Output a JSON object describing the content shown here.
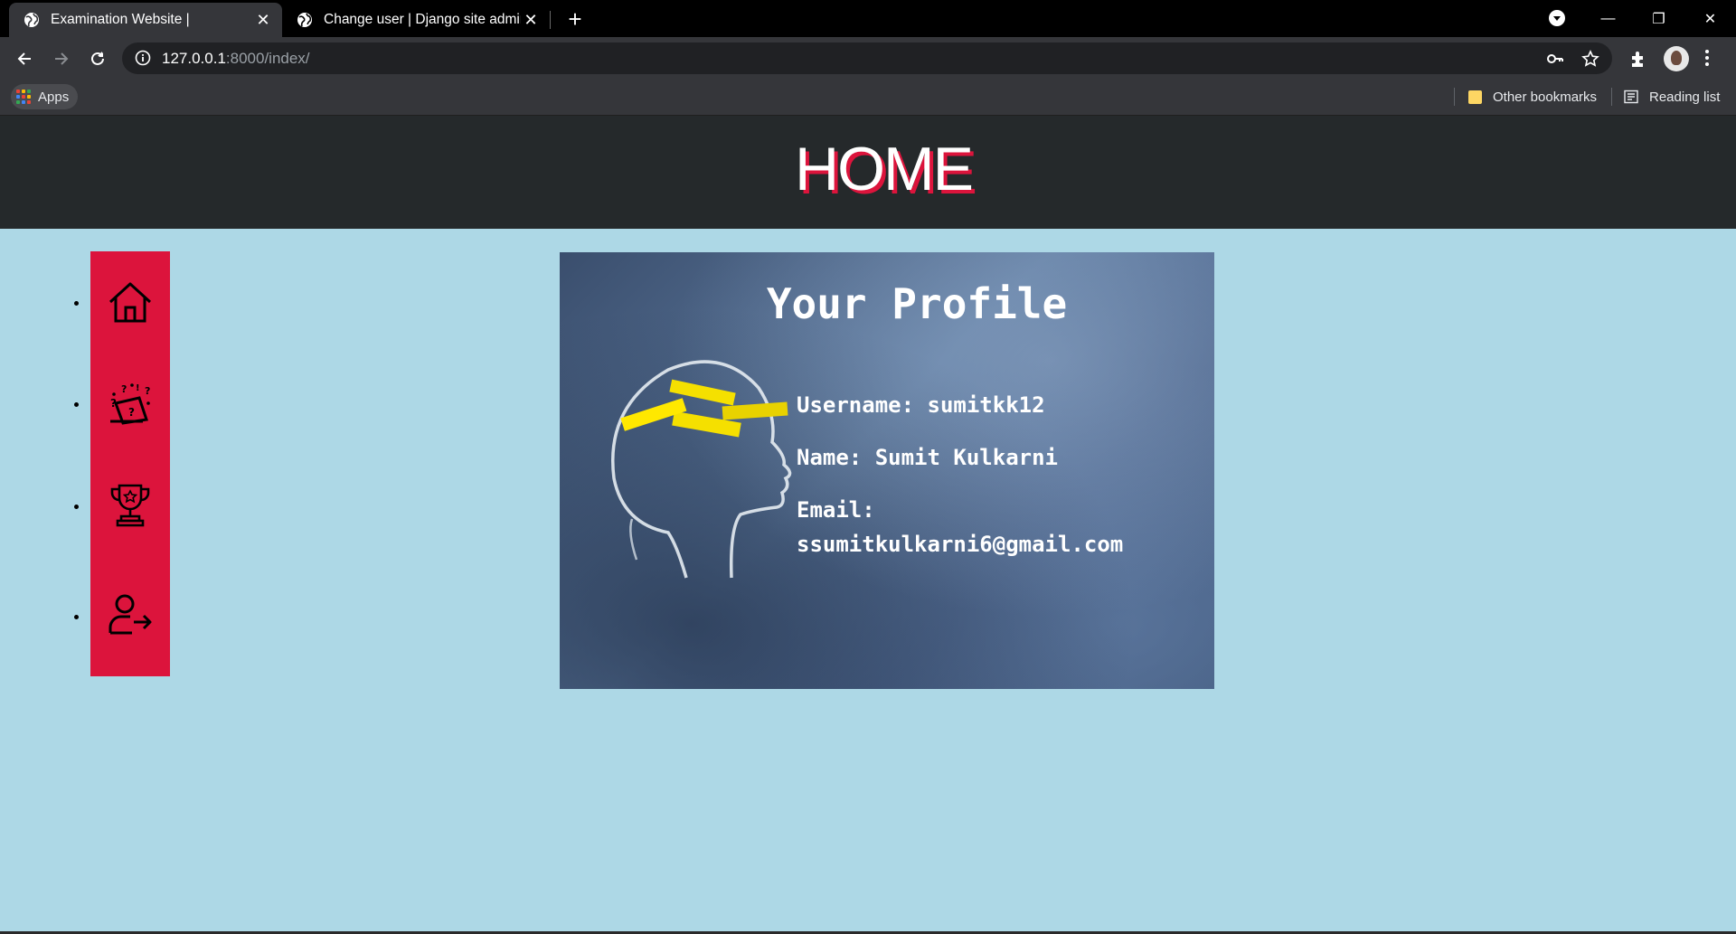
{
  "browser": {
    "tabs": [
      {
        "title": "Examination Website |",
        "active": true,
        "icon": "globe-icon"
      },
      {
        "title": "Change user | Django site admin",
        "active": false,
        "icon": "globe-icon"
      }
    ],
    "window_controls": {
      "minimize": "—",
      "restore": "❐",
      "close": "✕"
    },
    "url": {
      "host": "127.0.0.1",
      "rest": ":8000/index/"
    },
    "bookmarks": {
      "apps_label": "Apps",
      "other_bookmarks": "Other bookmarks",
      "reading_list": "Reading list"
    }
  },
  "page": {
    "header_title": "HOME",
    "sidebar_items": [
      {
        "icon": "home-icon"
      },
      {
        "icon": "quiz-icon"
      },
      {
        "icon": "trophy-icon"
      },
      {
        "icon": "logout-icon"
      }
    ],
    "profile": {
      "title": "Your Profile",
      "username_line": "Username: sumitkk12",
      "name_line": "Name: Sumit Kulkarni",
      "email_label": "Email:",
      "email_value": "ssumitkulkarni6@gmail.com"
    }
  },
  "colors": {
    "page_background": "#add8e6",
    "header_background": "#25292b",
    "accent": "#dc143c"
  }
}
